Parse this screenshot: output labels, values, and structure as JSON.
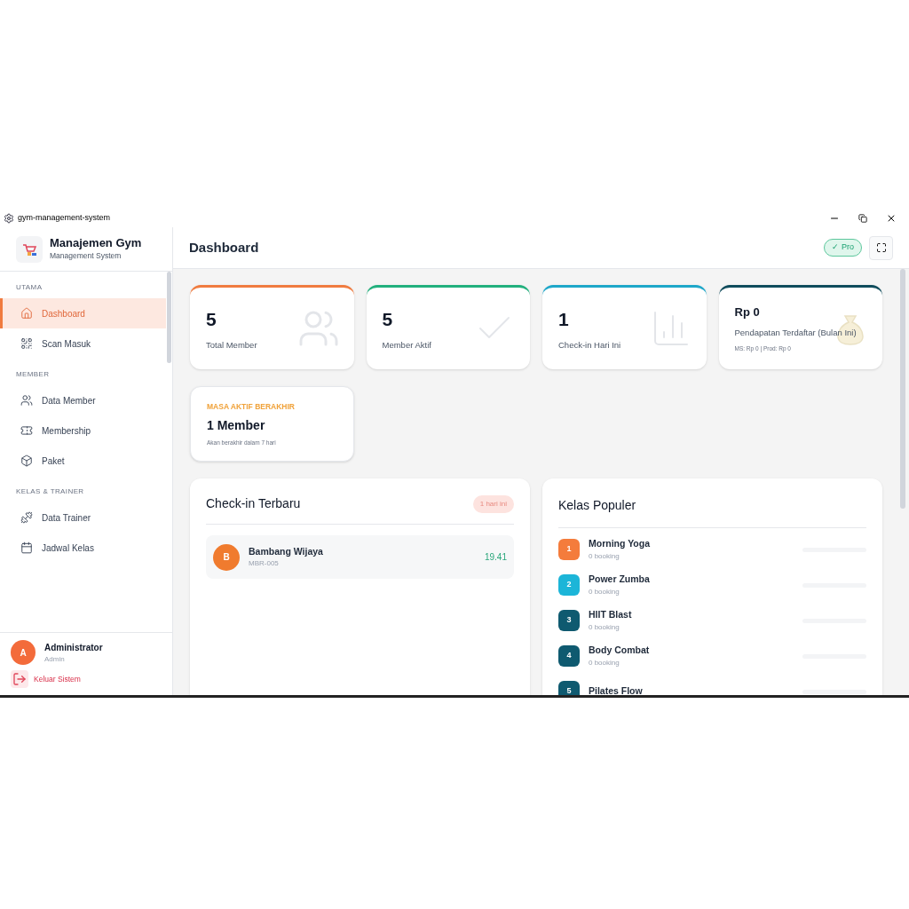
{
  "window": {
    "title": "gym-management-system"
  },
  "sidebar": {
    "brand": {
      "title": "Manajemen Gym",
      "subtitle": "Management System"
    },
    "sections": [
      {
        "heading": "UTAMA",
        "items": [
          {
            "label": "Dashboard",
            "selected": true
          },
          {
            "label": "Scan Masuk",
            "selected": false
          }
        ]
      },
      {
        "heading": "MEMBER",
        "items": [
          {
            "label": "Data Member",
            "selected": false
          },
          {
            "label": "Membership",
            "selected": false
          },
          {
            "label": "Paket",
            "selected": false
          }
        ]
      },
      {
        "heading": "KELAS & TRAINER",
        "items": [
          {
            "label": "Data Trainer",
            "selected": false
          },
          {
            "label": "Jadwal Kelas",
            "selected": false
          }
        ]
      }
    ],
    "user": {
      "initial": "A",
      "name": "Administrator",
      "role": "Admin"
    },
    "logout": "Keluar Sistem"
  },
  "header": {
    "title": "Dashboard",
    "badge": "✓ Pro"
  },
  "stats": [
    {
      "value": "5",
      "label": "Total Member",
      "color": "#f07b3f"
    },
    {
      "value": "5",
      "label": "Member Aktif",
      "color": "#22b07d"
    },
    {
      "value": "1",
      "label": "Check-in Hari Ini",
      "color": "#1ea7c9"
    },
    {
      "value": "Rp 0",
      "label": "Pendapatan Terdaftar (Bulan Ini)",
      "note": "MS: Rp 0 | Prod: Rp 0",
      "color": "#0f4c5c"
    }
  ],
  "expiring": {
    "heading": "MASA AKTIF BERAKHIR",
    "value": "1 Member",
    "note": "Akan berakhir dalam 7 hari"
  },
  "checkins": {
    "title": "Check-in Terbaru",
    "badge": "1 hari ini",
    "rows": [
      {
        "initial": "B",
        "name": "Bambang Wijaya",
        "id": "MBR-005",
        "time": "19.41"
      }
    ]
  },
  "classes": {
    "title": "Kelas Populer",
    "rows": [
      {
        "rank": "1",
        "name": "Morning Yoga",
        "bookings": "0 booking",
        "color": "#f47c3c",
        "level": 0
      },
      {
        "rank": "2",
        "name": "Power Zumba",
        "bookings": "0 booking",
        "color": "#1cb5d8",
        "level": 0
      },
      {
        "rank": "3",
        "name": "HIIT Blast",
        "bookings": "0 booking",
        "color": "#0f5a70",
        "level": 0
      },
      {
        "rank": "4",
        "name": "Body Combat",
        "bookings": "0 booking",
        "color": "#0f5a70",
        "level": 0
      },
      {
        "rank": "5",
        "name": "Pilates Flow",
        "color": "#0f5a70",
        "level": 0
      }
    ]
  }
}
